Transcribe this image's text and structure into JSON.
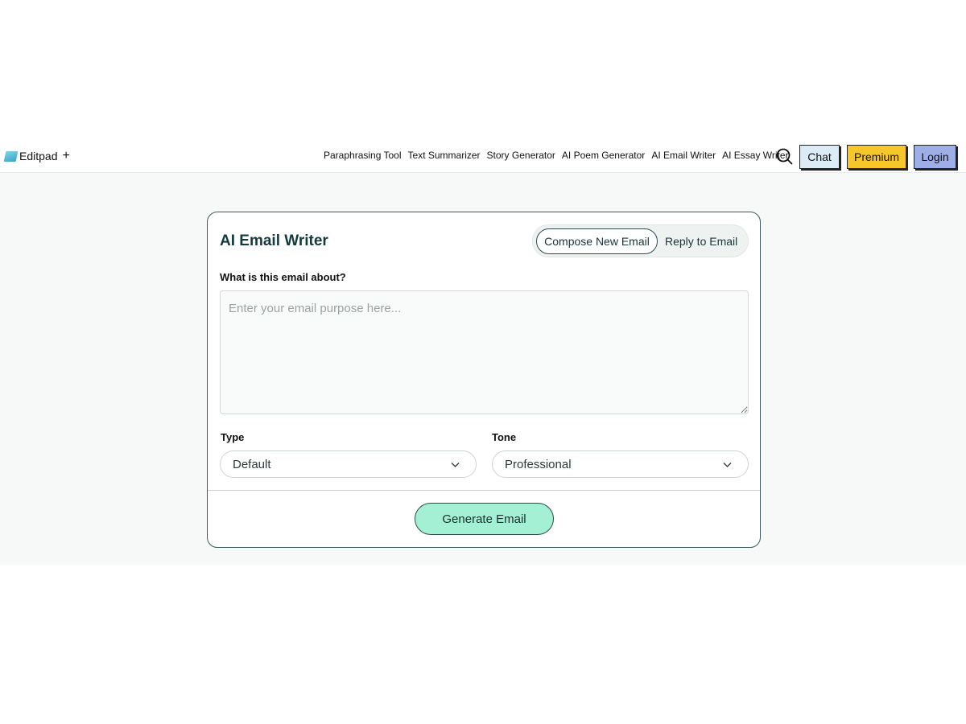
{
  "header": {
    "logo_text": "Editpad",
    "logo_plus": "+",
    "nav": [
      "Paraphrasing Tool",
      "Text Summarizer",
      "Story Generator",
      "AI Poem Generator",
      "AI Email Writer",
      "AI Essay Writer"
    ],
    "chat_label": "Chat",
    "premium_label": "Premium",
    "login_label": "Login"
  },
  "card": {
    "title": "AI Email Writer",
    "modes": {
      "compose": "Compose New Email",
      "reply": "Reply to Email",
      "active": "compose"
    },
    "question_label": "What is this email about?",
    "purpose_placeholder": "Enter your email purpose here...",
    "purpose_value": "",
    "type_label": "Type",
    "type_value": "Default",
    "tone_label": "Tone",
    "tone_value": "Professional",
    "generate_label": "Generate Email"
  },
  "colors": {
    "accent_green": "#a3f0d4",
    "premium_yellow": "#f7c629",
    "login_blue": "#9eaee6",
    "chat_blue": "#dcecf6",
    "title_teal": "#133a3c"
  }
}
